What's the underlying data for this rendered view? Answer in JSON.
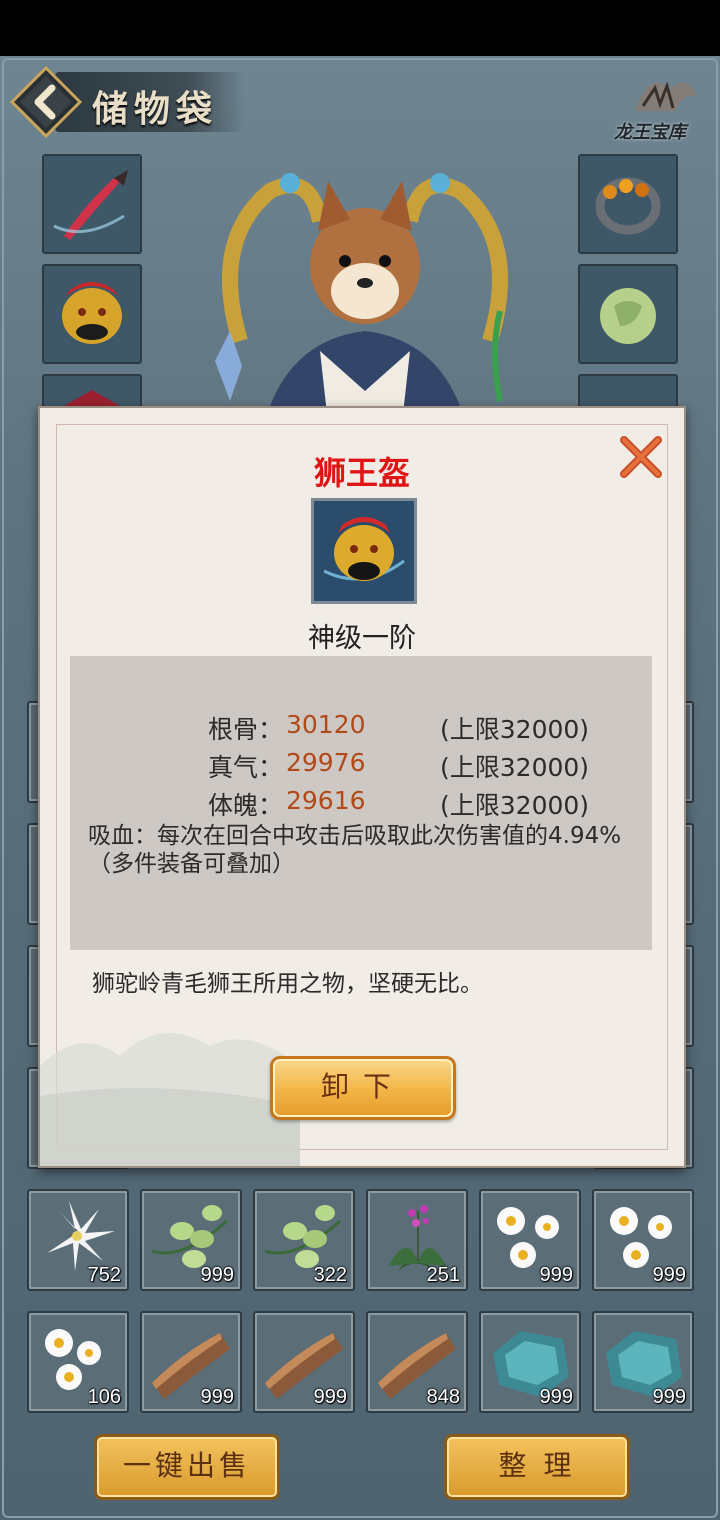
{
  "header": {
    "title": "储物袋",
    "treasure_label": "龙王宝库"
  },
  "equipment": {
    "left_slots": [
      "red-sword-icon",
      "lion-helmet-icon",
      "red-armor-icon"
    ],
    "right_slots": [
      "ring-icon",
      "jade-pendant-icon",
      "pink-orb-icon"
    ]
  },
  "inventory": {
    "row1": [
      {
        "icon": "white-lily-icon",
        "count": "752"
      },
      {
        "icon": "green-bean-herb-icon",
        "count": "999"
      },
      {
        "icon": "green-bean-herb-icon",
        "count": "322"
      },
      {
        "icon": "purple-orchid-icon",
        "count": "251"
      },
      {
        "icon": "daisy-flower-icon",
        "count": "999"
      },
      {
        "icon": "daisy-flower-icon",
        "count": "999"
      }
    ],
    "row2": [
      {
        "icon": "daisy-flower-icon",
        "count": "106"
      },
      {
        "icon": "wood-plank-icon",
        "count": "999"
      },
      {
        "icon": "wood-plank-icon",
        "count": "999"
      },
      {
        "icon": "wood-plank-icon",
        "count": "848"
      },
      {
        "icon": "teal-ore-icon",
        "count": "999"
      },
      {
        "icon": "teal-ore-icon",
        "count": "999"
      }
    ]
  },
  "buttons": {
    "sell_all": "一键出售",
    "organize": "整 理"
  },
  "popup": {
    "item_name": "狮王盔",
    "grade": "神级一阶",
    "stats": [
      {
        "label": "根骨：",
        "value": "30120",
        "cap": "(上限32000)"
      },
      {
        "label": "真气：",
        "value": "29976",
        "cap": "(上限32000)"
      },
      {
        "label": "体魄：",
        "value": "29616",
        "cap": "(上限32000)"
      }
    ],
    "effect_line1": "吸血：每次在回合中攻击后吸取此次伤害值的4.94%",
    "effect_line2": "（多件装备可叠加）",
    "description": "狮驼岭青毛狮王所用之物，坚硬无比。",
    "unequip_label": "卸下",
    "colors": {
      "name": "#e01414",
      "value": "#b04a1a"
    }
  }
}
